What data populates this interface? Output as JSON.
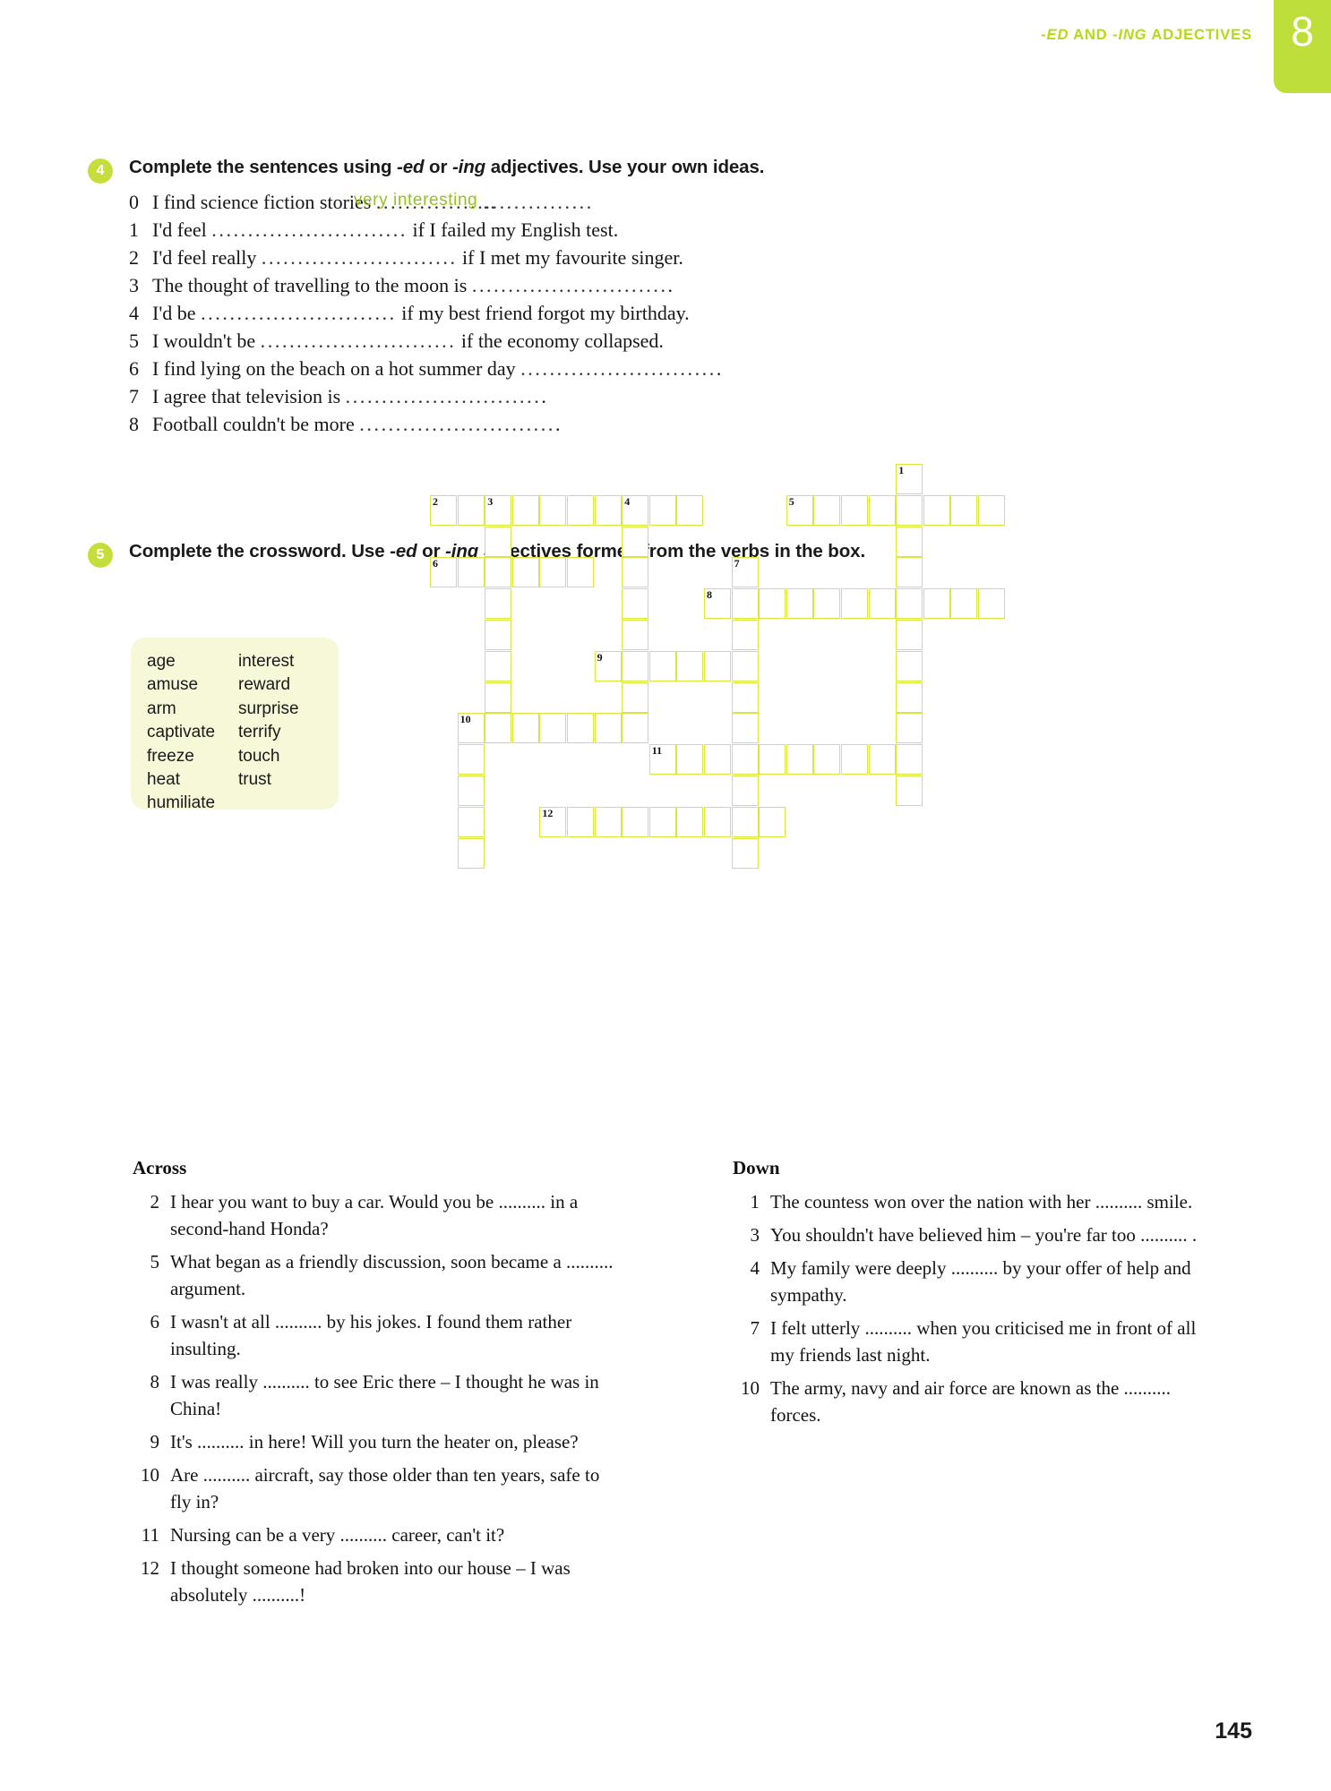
{
  "header": {
    "title_prefix": "-ED",
    "title_mid": " AND ",
    "title_ing": "-ING",
    "title_suffix": " ADJECTIVES",
    "unit_number": "8",
    "accent_color": "#b4d916",
    "tab_color": "#bede3a"
  },
  "exercise4": {
    "number": "4",
    "instruction_a": "Complete the sentences using ",
    "instruction_ed": "-ed",
    "instruction_or": " or ",
    "instruction_ing": "-ing",
    "instruction_b": " adjectives. Use your own ideas.",
    "handwritten_answer": "very interesting",
    "answer_color": "#96c11f",
    "items": [
      {
        "num": "0",
        "before": "I find science fiction stories ",
        "dots": "..............................",
        "after": ""
      },
      {
        "num": "1",
        "before": "I'd feel ",
        "dots": "...........................",
        "after": " if I failed my English test."
      },
      {
        "num": "2",
        "before": "I'd feel really ",
        "dots": "...........................",
        "after": " if I met my favourite singer."
      },
      {
        "num": "3",
        "before": "The thought of travelling to the moon is ",
        "dots": "...........................",
        "after": "."
      },
      {
        "num": "4",
        "before": "I'd be ",
        "dots": "...........................",
        "after": " if my best friend forgot my birthday."
      },
      {
        "num": "5",
        "before": "I wouldn't be ",
        "dots": "...........................",
        "after": " if the economy collapsed."
      },
      {
        "num": "6",
        "before": "I find lying on the beach on a hot summer day ",
        "dots": "...........................",
        "after": "."
      },
      {
        "num": "7",
        "before": "I agree that television is ",
        "dots": "...........................",
        "after": "."
      },
      {
        "num": "8",
        "before": "Football couldn't be more ",
        "dots": "...........................",
        "after": "."
      }
    ]
  },
  "exercise5": {
    "number": "5",
    "instruction_a": "Complete the crossword. Use ",
    "instruction_ed": "-ed",
    "instruction_or": " or ",
    "instruction_ing": "-ing",
    "instruction_b": " adjectives formed from the verbs in the box.",
    "wordbox": {
      "background": "#f6f8d8",
      "left_column": [
        "age",
        "amuse",
        "arm",
        "captivate",
        "freeze",
        "heat",
        "humiliate"
      ],
      "right_column": [
        "interest",
        "reward",
        "surprise",
        "terrify",
        "touch",
        "trust"
      ]
    },
    "crossword": {
      "cell_border_color": "#d6e83c",
      "cells": [
        {
          "col": 17,
          "row": 0,
          "label": "1"
        },
        {
          "col": 0,
          "row": 1,
          "label": "2"
        },
        {
          "col": 1,
          "row": 1,
          "label": ""
        },
        {
          "col": 2,
          "row": 1,
          "label": "3"
        },
        {
          "col": 3,
          "row": 1,
          "label": ""
        },
        {
          "col": 4,
          "row": 1,
          "label": ""
        },
        {
          "col": 5,
          "row": 1,
          "label": ""
        },
        {
          "col": 6,
          "row": 1,
          "label": ""
        },
        {
          "col": 7,
          "row": 1,
          "label": "4"
        },
        {
          "col": 8,
          "row": 1,
          "label": ""
        },
        {
          "col": 9,
          "row": 1,
          "label": ""
        },
        {
          "col": 13,
          "row": 1,
          "label": "5"
        },
        {
          "col": 14,
          "row": 1,
          "label": ""
        },
        {
          "col": 15,
          "row": 1,
          "label": ""
        },
        {
          "col": 16,
          "row": 1,
          "label": ""
        },
        {
          "col": 17,
          "row": 1,
          "label": ""
        },
        {
          "col": 18,
          "row": 1,
          "label": ""
        },
        {
          "col": 19,
          "row": 1,
          "label": ""
        },
        {
          "col": 20,
          "row": 1,
          "label": ""
        },
        {
          "col": 2,
          "row": 2,
          "label": ""
        },
        {
          "col": 7,
          "row": 2,
          "label": ""
        },
        {
          "col": 17,
          "row": 2,
          "label": ""
        },
        {
          "col": 0,
          "row": 3,
          "label": "6"
        },
        {
          "col": 1,
          "row": 3,
          "label": ""
        },
        {
          "col": 2,
          "row": 3,
          "label": ""
        },
        {
          "col": 3,
          "row": 3,
          "label": ""
        },
        {
          "col": 4,
          "row": 3,
          "label": ""
        },
        {
          "col": 5,
          "row": 3,
          "label": ""
        },
        {
          "col": 7,
          "row": 3,
          "label": ""
        },
        {
          "col": 11,
          "row": 3,
          "label": "7"
        },
        {
          "col": 17,
          "row": 3,
          "label": ""
        },
        {
          "col": 2,
          "row": 4,
          "label": ""
        },
        {
          "col": 7,
          "row": 4,
          "label": ""
        },
        {
          "col": 10,
          "row": 4,
          "label": "8"
        },
        {
          "col": 11,
          "row": 4,
          "label": ""
        },
        {
          "col": 12,
          "row": 4,
          "label": ""
        },
        {
          "col": 13,
          "row": 4,
          "label": ""
        },
        {
          "col": 14,
          "row": 4,
          "label": ""
        },
        {
          "col": 15,
          "row": 4,
          "label": ""
        },
        {
          "col": 16,
          "row": 4,
          "label": ""
        },
        {
          "col": 17,
          "row": 4,
          "label": ""
        },
        {
          "col": 18,
          "row": 4,
          "label": ""
        },
        {
          "col": 19,
          "row": 4,
          "label": ""
        },
        {
          "col": 20,
          "row": 4,
          "label": ""
        },
        {
          "col": 2,
          "row": 5,
          "label": ""
        },
        {
          "col": 7,
          "row": 5,
          "label": ""
        },
        {
          "col": 11,
          "row": 5,
          "label": ""
        },
        {
          "col": 17,
          "row": 5,
          "label": ""
        },
        {
          "col": 2,
          "row": 6,
          "label": ""
        },
        {
          "col": 6,
          "row": 6,
          "label": "9"
        },
        {
          "col": 7,
          "row": 6,
          "label": ""
        },
        {
          "col": 8,
          "row": 6,
          "label": ""
        },
        {
          "col": 9,
          "row": 6,
          "label": ""
        },
        {
          "col": 10,
          "row": 6,
          "label": ""
        },
        {
          "col": 11,
          "row": 6,
          "label": ""
        },
        {
          "col": 17,
          "row": 6,
          "label": ""
        },
        {
          "col": 2,
          "row": 7,
          "label": ""
        },
        {
          "col": 7,
          "row": 7,
          "label": ""
        },
        {
          "col": 11,
          "row": 7,
          "label": ""
        },
        {
          "col": 17,
          "row": 7,
          "label": ""
        },
        {
          "col": 1,
          "row": 8,
          "label": "10"
        },
        {
          "col": 2,
          "row": 8,
          "label": ""
        },
        {
          "col": 3,
          "row": 8,
          "label": ""
        },
        {
          "col": 4,
          "row": 8,
          "label": ""
        },
        {
          "col": 5,
          "row": 8,
          "label": ""
        },
        {
          "col": 6,
          "row": 8,
          "label": ""
        },
        {
          "col": 7,
          "row": 8,
          "label": ""
        },
        {
          "col": 11,
          "row": 8,
          "label": ""
        },
        {
          "col": 17,
          "row": 8,
          "label": ""
        },
        {
          "col": 1,
          "row": 9,
          "label": ""
        },
        {
          "col": 8,
          "row": 9,
          "label": "11"
        },
        {
          "col": 9,
          "row": 9,
          "label": ""
        },
        {
          "col": 10,
          "row": 9,
          "label": ""
        },
        {
          "col": 11,
          "row": 9,
          "label": ""
        },
        {
          "col": 12,
          "row": 9,
          "label": ""
        },
        {
          "col": 13,
          "row": 9,
          "label": ""
        },
        {
          "col": 14,
          "row": 9,
          "label": ""
        },
        {
          "col": 15,
          "row": 9,
          "label": ""
        },
        {
          "col": 16,
          "row": 9,
          "label": ""
        },
        {
          "col": 17,
          "row": 9,
          "label": ""
        },
        {
          "col": 1,
          "row": 10,
          "label": ""
        },
        {
          "col": 11,
          "row": 10,
          "label": ""
        },
        {
          "col": 17,
          "row": 10,
          "label": ""
        },
        {
          "col": 1,
          "row": 11,
          "label": ""
        },
        {
          "col": 4,
          "row": 11,
          "label": "12"
        },
        {
          "col": 5,
          "row": 11,
          "label": ""
        },
        {
          "col": 6,
          "row": 11,
          "label": ""
        },
        {
          "col": 7,
          "row": 11,
          "label": ""
        },
        {
          "col": 8,
          "row": 11,
          "label": ""
        },
        {
          "col": 9,
          "row": 11,
          "label": ""
        },
        {
          "col": 10,
          "row": 11,
          "label": ""
        },
        {
          "col": 11,
          "row": 11,
          "label": ""
        },
        {
          "col": 12,
          "row": 11,
          "label": ""
        },
        {
          "col": 1,
          "row": 12,
          "label": ""
        },
        {
          "col": 11,
          "row": 12,
          "label": ""
        }
      ]
    },
    "clues": {
      "across_heading": "Across",
      "down_heading": "Down",
      "across": [
        {
          "num": "2",
          "text": "I hear you want to buy a car. Would you be .......... in a second-hand Honda?"
        },
        {
          "num": "5",
          "text": "What began as a friendly discussion, soon became a .......... argument."
        },
        {
          "num": "6",
          "text": "I wasn't at all .......... by his jokes. I found them rather insulting."
        },
        {
          "num": "8",
          "text": "I was really .......... to see Eric there – I thought he was in China!"
        },
        {
          "num": "9",
          "text": "It's .......... in here! Will you turn the heater on, please?"
        },
        {
          "num": "10",
          "text": "Are .......... aircraft, say those older than ten years, safe to fly in?"
        },
        {
          "num": "11",
          "text": "Nursing can be a very .......... career, can't it?"
        },
        {
          "num": "12",
          "text": "I thought someone had broken into our house – I was absolutely ..........!"
        }
      ],
      "down": [
        {
          "num": "1",
          "text": "The countess won over the nation with her .......... smile."
        },
        {
          "num": "3",
          "text": "You shouldn't have believed him – you're far too .......... ."
        },
        {
          "num": "4",
          "text": "My family were deeply .......... by your offer of help and sympathy."
        },
        {
          "num": "7",
          "text": "I felt utterly .......... when you criticised me in front of all my friends last night."
        },
        {
          "num": "10",
          "text": "The army, navy and air force are known as the .......... forces."
        }
      ]
    }
  },
  "page_number": "145"
}
